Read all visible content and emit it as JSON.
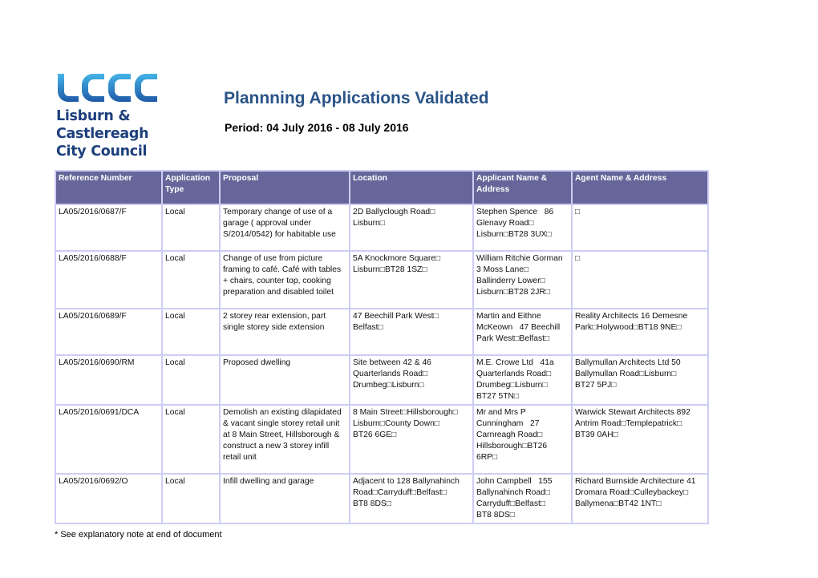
{
  "header": {
    "logo_alt": "LCCC",
    "logo_lines": [
      "Lisburn &",
      "Castlereagh",
      "City Council"
    ],
    "title": "Plannning Applications Validated",
    "period": "Period: 04 July 2016 - 08 July 2016"
  },
  "colors": {
    "header_bg": "#66669a",
    "grid": "#cdcdf5",
    "title": "#2a5487",
    "logo_blue": "#1d3f7c"
  },
  "table": {
    "columns": [
      "Reference Number",
      "Application Type",
      "Proposal",
      "Location",
      "Applicant Name & Address",
      "Agent Name & Address"
    ],
    "rows": [
      {
        "ref": "LA05/2016/0687/F",
        "type": "Local",
        "proposal": [
          "Temporary change of use of a",
          "garage ( approval under",
          "S/2014/0542) for habitable use"
        ],
        "location": [
          "2D Ballyclough Road□",
          "Lisburn□"
        ],
        "applicant": [
          "Stephen Spence   86",
          "Glenavy Road□",
          "Lisburn□BT28 3UX□"
        ],
        "agent": [
          "□"
        ]
      },
      {
        "ref": "LA05/2016/0688/F",
        "type": "Local",
        "proposal": [
          "Change of use from picture",
          "framing to café. Café with tables",
          "+ chairs, counter top, cooking",
          "preparation and disabled toilet"
        ],
        "location": [
          "5A Knockmore Square□",
          "Lisburn□BT28 1SZ□"
        ],
        "applicant": [
          "William Ritchie Gorman",
          "3 Moss Lane□",
          "Ballinderry Lower□",
          "Lisburn□BT28 2JR□"
        ],
        "agent": [
          "□"
        ]
      },
      {
        "ref": "LA05/2016/0689/F",
        "type": "Local",
        "proposal": [
          "2 storey rear extension, part",
          "single storey side extension"
        ],
        "location": [
          "47 Beechill Park West□",
          "Belfast□"
        ],
        "applicant": [
          "Martin and Eithne",
          "McKeown   47 Beechill",
          "Park West□Belfast□"
        ],
        "agent": [
          "Reality Architects 16 Demesne",
          "Park□Holywood□BT18 9NE□"
        ]
      },
      {
        "ref": "LA05/2016/0690/RM",
        "type": "Local",
        "proposal": [
          "Proposed dwelling"
        ],
        "location": [
          "Site between 42 & 46",
          "Quarterlands Road□",
          "Drumbeg□Lisburn□"
        ],
        "applicant": [
          "M.E. Crowe Ltd   41a",
          "Quarterlands Road□",
          "Drumbeg□Lisburn□",
          "BT27 5TN□"
        ],
        "agent": [
          "Ballymullan Architects Ltd 50",
          "Ballymullan Road□Lisburn□",
          "BT27 5PJ□"
        ]
      },
      {
        "ref": "LA05/2016/0691/DCA",
        "type": "Local",
        "proposal": [
          "Demolish an existing dilapidated",
          "& vacant single storey retail unit",
          "at 8 Main Street, Hillsborough &",
          "construct a new 3 storey infill",
          "retail unit"
        ],
        "location": [
          "8 Main Street□Hillsborough□",
          "Lisburn□County Down□",
          "BT26 6GE□"
        ],
        "applicant": [
          "Mr and Mrs P",
          "Cunningham   27",
          "Carnreagh Road□",
          "Hillsborough□BT26",
          "6RP□"
        ],
        "agent": [
          "Warwick Stewart Architects 892",
          "Antrim Road□Templepatrick□",
          "BT39 0AH□"
        ]
      },
      {
        "ref": "LA05/2016/0692/O",
        "type": "Local",
        "proposal": [
          "Infill dwelling and garage"
        ],
        "location": [
          "Adjacent to 128 Ballynahinch",
          "Road□Carryduff□Belfast□",
          "BT8 8DS□"
        ],
        "applicant": [
          "John Campbell   155",
          "Ballynahinch Road□",
          "Carryduff□Belfast□",
          "BT8 8DS□"
        ],
        "agent": [
          "Richard Burnside Architecture 41",
          "Dromara Road□Culleybackey□",
          "Ballymena□BT42 1NT□"
        ]
      }
    ]
  },
  "footnote": "* See explanatory note at end of document"
}
